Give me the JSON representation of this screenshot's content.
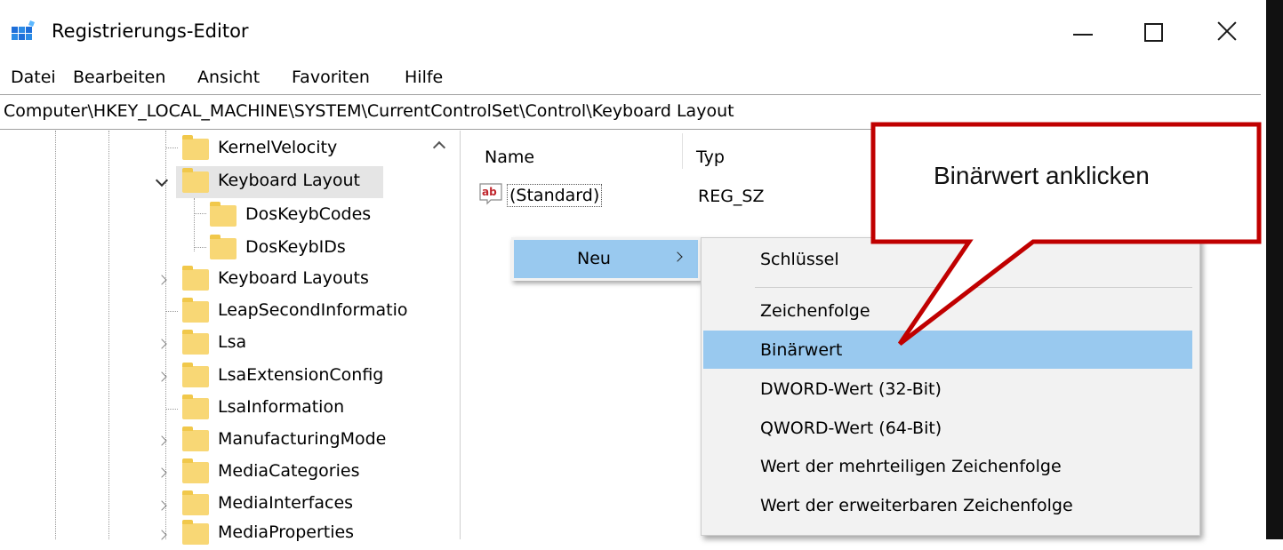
{
  "window": {
    "title": "Registrierungs-Editor",
    "controls": [
      "minimize",
      "maximize",
      "close"
    ]
  },
  "menu": {
    "items": [
      "Datei",
      "Bearbeiten",
      "Ansicht",
      "Favoriten",
      "Hilfe"
    ]
  },
  "address": "Computer\\HKEY_LOCAL_MACHINE\\SYSTEM\\CurrentControlSet\\Control\\Keyboard Layout",
  "tree": {
    "nodes": [
      {
        "label": "KernelVelocity",
        "expander": "none"
      },
      {
        "label": "Keyboard Layout",
        "expander": "expanded",
        "selected": true
      },
      {
        "label": "DosKeybCodes",
        "expander": "none"
      },
      {
        "label": "DosKeybIDs",
        "expander": "none"
      },
      {
        "label": "Keyboard Layouts",
        "expander": "collapsed"
      },
      {
        "label": "LeapSecondInformatio",
        "expander": "none"
      },
      {
        "label": "Lsa",
        "expander": "collapsed"
      },
      {
        "label": "LsaExtensionConfig",
        "expander": "collapsed"
      },
      {
        "label": "LsaInformation",
        "expander": "none"
      },
      {
        "label": "ManufacturingMode",
        "expander": "collapsed"
      },
      {
        "label": "MediaCategories",
        "expander": "collapsed"
      },
      {
        "label": "MediaInterfaces",
        "expander": "collapsed"
      },
      {
        "label": "MediaProperties",
        "expander": "collapsed"
      }
    ]
  },
  "list": {
    "columns": [
      "Name",
      "Typ"
    ],
    "rows": [
      {
        "icon": "ab-string-icon",
        "name": "(Standard)",
        "type": "REG_SZ"
      }
    ]
  },
  "context_menu": {
    "parent_label": "Neu",
    "submenu": [
      "Schlüssel",
      "Zeichenfolge",
      "Binärwert",
      "DWORD-Wert (32-Bit)",
      "QWORD-Wert (64-Bit)",
      "Wert der mehrteiligen Zeichenfolge",
      "Wert der erweiterbaren Zeichenfolge"
    ],
    "highlighted": "Binärwert"
  },
  "callout": {
    "text": "Binärwert anklicken",
    "border_color": "#c00000"
  }
}
